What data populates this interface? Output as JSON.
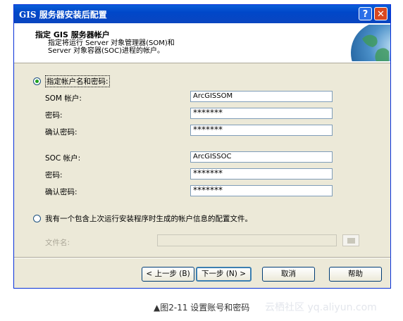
{
  "window": {
    "title": "GIS 服务器安装后配置",
    "help_glyph": "?",
    "close_glyph": "✕"
  },
  "header": {
    "title": "指定 GIS 服务器帐户",
    "description_line1": "指定将运行 Server 对象管理器(SOM)和",
    "description_line2": "Server 对象容器(SOC)进程的帐户。"
  },
  "option_specify": {
    "label": "指定帐户名和密码:",
    "selected": true,
    "som_account_label": "SOM 帐户:",
    "som_account_value": "ArcGISSOM",
    "som_password_label": "密码:",
    "som_password_value": "*******",
    "som_confirm_label": "确认密码:",
    "som_confirm_value": "*******",
    "soc_account_label": "SOC 帐户:",
    "soc_account_value": "ArcGISSOC",
    "soc_password_label": "密码:",
    "soc_password_value": "*******",
    "soc_confirm_label": "确认密码:",
    "soc_confirm_value": "*******"
  },
  "option_config_file": {
    "label": "我有一个包含上次运行安装程序时生成的帐户信息的配置文件。",
    "selected": false,
    "filename_label": "文件名:",
    "filename_value": ""
  },
  "buttons": {
    "back": "< 上一步 (B)",
    "next": "下一步 (N) >",
    "cancel": "取消",
    "help": "帮助"
  },
  "caption": "▲图2-11 设置账号和密码",
  "watermark": "云栖社区 yq.aliyun.com"
}
